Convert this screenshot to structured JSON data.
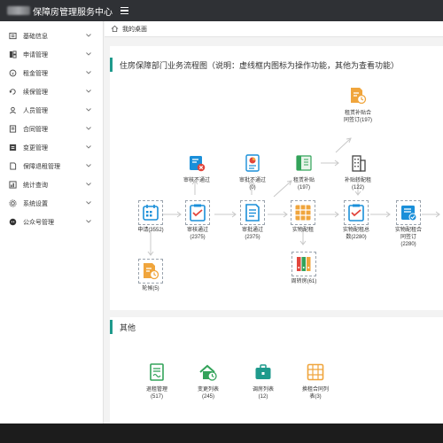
{
  "header": {
    "title": "保障房管理服务中心"
  },
  "breadcrumb": {
    "label": "我的桌面"
  },
  "sidebar": {
    "items": [
      {
        "label": "基础信息",
        "icon": "info-card-icon"
      },
      {
        "label": "申请管理",
        "icon": "apply-icon"
      },
      {
        "label": "租金管理",
        "icon": "coin-icon"
      },
      {
        "label": "续保管理",
        "icon": "renew-icon"
      },
      {
        "label": "人员管理",
        "icon": "person-icon"
      },
      {
        "label": "合同管理",
        "icon": "contract-icon"
      },
      {
        "label": "变更管理",
        "icon": "change-icon"
      },
      {
        "label": "保障退租管理",
        "icon": "exit-icon"
      },
      {
        "label": "统计查询",
        "icon": "stats-icon"
      },
      {
        "label": "系统设置",
        "icon": "settings-icon"
      },
      {
        "label": "公众号管理",
        "icon": "wechat-icon"
      }
    ]
  },
  "flow": {
    "title": "住房保障部门业务流程图（说明：虚线框内图标为操作功能，其他为查看功能）",
    "nodes": {
      "apply": "申请(3552)",
      "review_pass": "审核通过\n(2375)",
      "approve_pass": "审批通过\n(2375)",
      "physical": "实物配租",
      "physical_total": "实物配租总\n数(2280)",
      "physical_signed": "实物配租合\n同签订\n(2280)",
      "wait": "轮候(5)",
      "review_fail": "审核不通过",
      "approve_fail": "审批不通过\n(0)",
      "rent_subsidy": "租赁补贴\n(197)",
      "subsidy_to_physical": "补贴转配租\n(122)",
      "subsidy_contract": "租赁补贴合\n同签订(197)",
      "turnover": "周转房(61)"
    }
  },
  "other": {
    "title": "其他",
    "items": [
      {
        "label": "退租管理\n(517)"
      },
      {
        "label": "变更列表\n(245)"
      },
      {
        "label": "调房列表\n(12)"
      },
      {
        "label": "换租合同列\n表(3)"
      }
    ]
  },
  "colors": {
    "teal": "#1f9a8c",
    "blue": "#1a8fd9",
    "orange": "#f0a53c",
    "green": "#33a35a",
    "red": "#e2453c",
    "topbar": "#2f3135"
  }
}
